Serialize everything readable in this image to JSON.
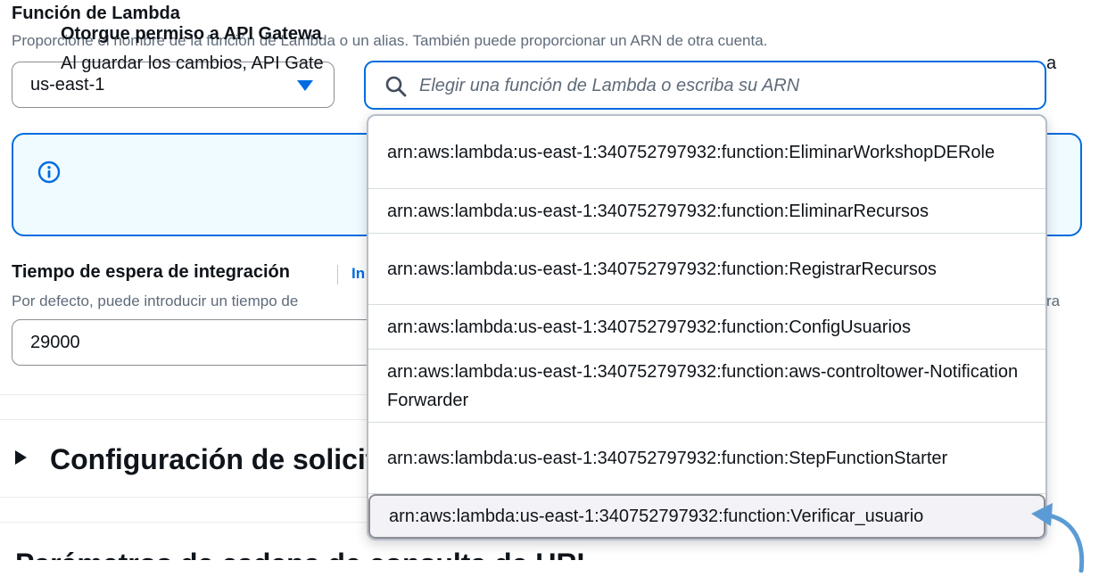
{
  "lambda": {
    "label": "Función de Lambda",
    "description": "Proporcione el nombre de la función de Lambda o un alias. También puede proporcionar un ARN de otra cuenta.",
    "region": "us-east-1",
    "search_placeholder": "Elegir una función de Lambda o escriba su ARN"
  },
  "alert": {
    "title": "Otorgue permiso a API Gatewa",
    "text": "Al guardar los cambios, API Gate",
    "tail": "a"
  },
  "timeout": {
    "label": "Tiempo de espera de integración",
    "info_link": "In",
    "description": "Por defecto, puede introducir un tiempo de",
    "tail": "ra",
    "value": "29000"
  },
  "sections": {
    "request_config": "Configuración de solicit",
    "url_params": "Parámetros de cadena de consulta de URL"
  },
  "dropdown": {
    "options": [
      "arn:aws:lambda:us-east-1:340752797932:function:EliminarWorkshopDERole",
      "arn:aws:lambda:us-east-1:340752797932:function:EliminarRecursos",
      "arn:aws:lambda:us-east-1:340752797932:function:RegistrarRecursos",
      "arn:aws:lambda:us-east-1:340752797932:function:ConfigUsuarios",
      "arn:aws:lambda:us-east-1:340752797932:function:aws-controltower-NotificationForwarder",
      "arn:aws:lambda:us-east-1:340752797932:function:StepFunctionStarter",
      "arn:aws:lambda:us-east-1:340752797932:function:Verificar_usuario"
    ]
  },
  "colors": {
    "accent": "#006ce0",
    "alert_bg": "#f0fbff",
    "annotation_arrow": "#5b9bd5"
  }
}
